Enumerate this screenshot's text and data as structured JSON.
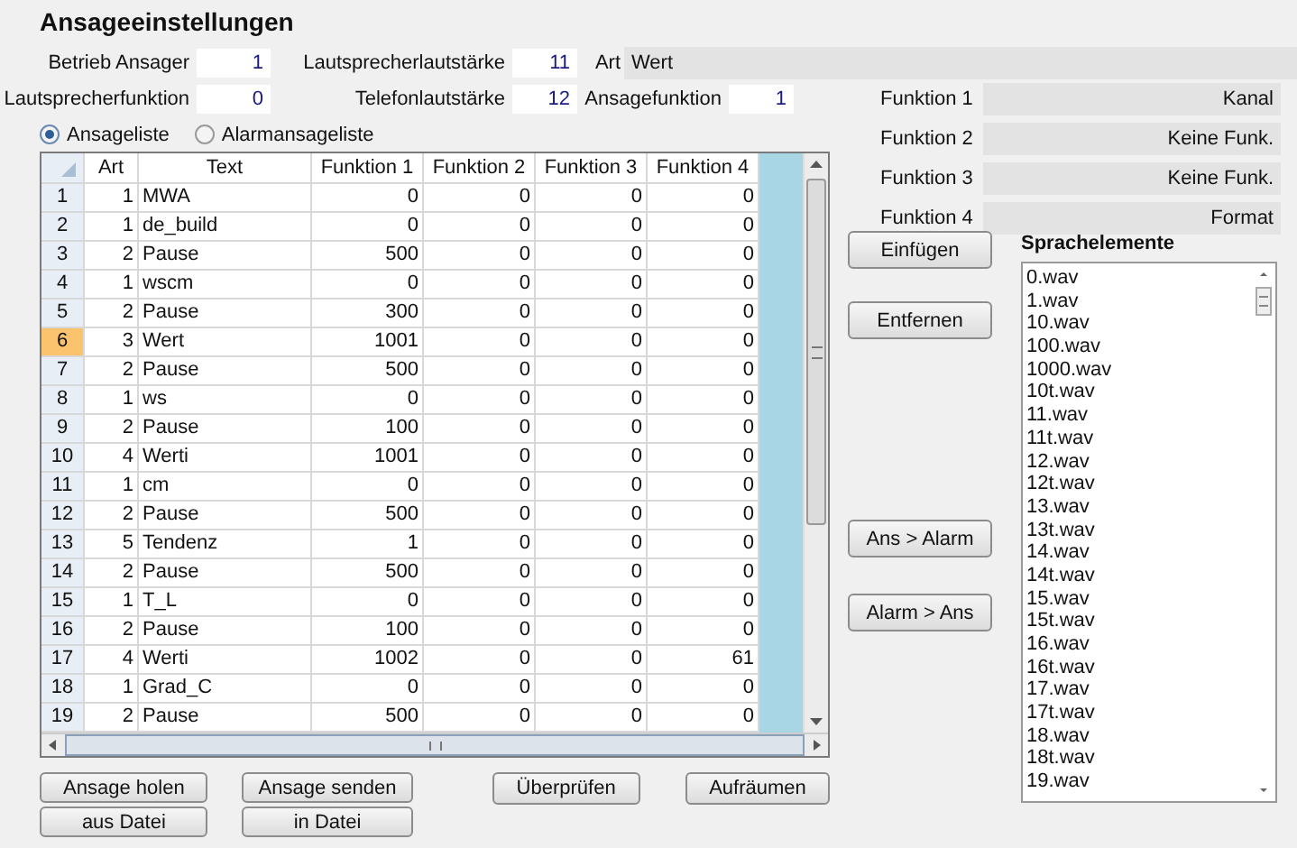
{
  "title": "Ansageeinstellungen",
  "settings_row_1": [
    {
      "label": "Betrieb Ansager",
      "value": "1"
    },
    {
      "label": "Lautsprecherlautstärke",
      "value": "11"
    }
  ],
  "art": {
    "label": "Art",
    "value": "Wert"
  },
  "settings_row_2": [
    {
      "label": "Lautsprecherfunktion",
      "value": "0"
    },
    {
      "label": "Telefonlautstärke",
      "value": "12"
    },
    {
      "label": "Ansagefunktion",
      "value": "1"
    }
  ],
  "list_mode": [
    {
      "label": "Ansageliste",
      "selected": true
    },
    {
      "label": "Alarmansageliste",
      "selected": false
    }
  ],
  "table": {
    "columns": [
      "Art",
      "Text",
      "Funktion 1",
      "Funktion 2",
      "Funktion 3",
      "Funktion 4"
    ],
    "rows": [
      {
        "number": "1",
        "cells": [
          "1",
          "MWA",
          "0",
          "0",
          "0",
          "0"
        ],
        "selected": false
      },
      {
        "number": "2",
        "cells": [
          "1",
          "de_build",
          "0",
          "0",
          "0",
          "0"
        ],
        "selected": false
      },
      {
        "number": "3",
        "cells": [
          "2",
          "Pause",
          "500",
          "0",
          "0",
          "0"
        ],
        "selected": false
      },
      {
        "number": "4",
        "cells": [
          "1",
          "wscm",
          "0",
          "0",
          "0",
          "0"
        ],
        "selected": false
      },
      {
        "number": "5",
        "cells": [
          "2",
          "Pause",
          "300",
          "0",
          "0",
          "0"
        ],
        "selected": false
      },
      {
        "number": "6",
        "cells": [
          "3",
          "Wert",
          "1001",
          "0",
          "0",
          "0"
        ],
        "selected": true
      },
      {
        "number": "7",
        "cells": [
          "2",
          "Pause",
          "500",
          "0",
          "0",
          "0"
        ],
        "selected": false
      },
      {
        "number": "8",
        "cells": [
          "1",
          "ws",
          "0",
          "0",
          "0",
          "0"
        ],
        "selected": false
      },
      {
        "number": "9",
        "cells": [
          "2",
          "Pause",
          "100",
          "0",
          "0",
          "0"
        ],
        "selected": false
      },
      {
        "number": "10",
        "cells": [
          "4",
          "Werti",
          "1001",
          "0",
          "0",
          "0"
        ],
        "selected": false
      },
      {
        "number": "11",
        "cells": [
          "1",
          "cm",
          "0",
          "0",
          "0",
          "0"
        ],
        "selected": false
      },
      {
        "number": "12",
        "cells": [
          "2",
          "Pause",
          "500",
          "0",
          "0",
          "0"
        ],
        "selected": false
      },
      {
        "number": "13",
        "cells": [
          "5",
          "Tendenz",
          "1",
          "0",
          "0",
          "0"
        ],
        "selected": false
      },
      {
        "number": "14",
        "cells": [
          "2",
          "Pause",
          "500",
          "0",
          "0",
          "0"
        ],
        "selected": false
      },
      {
        "number": "15",
        "cells": [
          "1",
          "T_L",
          "0",
          "0",
          "0",
          "0"
        ],
        "selected": false
      },
      {
        "number": "16",
        "cells": [
          "2",
          "Pause",
          "100",
          "0",
          "0",
          "0"
        ],
        "selected": false
      },
      {
        "number": "17",
        "cells": [
          "4",
          "Werti",
          "1002",
          "0",
          "0",
          "61"
        ],
        "selected": false
      },
      {
        "number": "18",
        "cells": [
          "1",
          "Grad_C",
          "0",
          "0",
          "0",
          "0"
        ],
        "selected": false
      },
      {
        "number": "19",
        "cells": [
          "2",
          "Pause",
          "500",
          "0",
          "0",
          "0"
        ],
        "selected": false
      }
    ]
  },
  "bottom_buttons": [
    [
      "Ansage holen",
      "aus Datei"
    ],
    [
      "Ansage senden",
      "in Datei"
    ],
    [
      "Überprüfen"
    ],
    [
      "Aufräumen"
    ]
  ],
  "functions": [
    {
      "label": "Funktion 1",
      "value": "Kanal"
    },
    {
      "label": "Funktion 2",
      "value": "Keine Funk."
    },
    {
      "label": "Funktion 3",
      "value": "Keine Funk."
    },
    {
      "label": "Funktion 4",
      "value": "Format"
    }
  ],
  "side_buttons": [
    "Einfügen",
    "Entfernen",
    "Ans > Alarm",
    "Alarm > Ans"
  ],
  "speech_elements": {
    "title": "Sprachelemente",
    "items": [
      "0.wav",
      "1.wav",
      "10.wav",
      "100.wav",
      "1000.wav",
      "10t.wav",
      "11.wav",
      "11t.wav",
      "12.wav",
      "12t.wav",
      "13.wav",
      "13t.wav",
      "14.wav",
      "14t.wav",
      "15.wav",
      "15t.wav",
      "16.wav",
      "16t.wav",
      "17.wav",
      "17t.wav",
      "18.wav",
      "18t.wav",
      "19.wav"
    ]
  }
}
